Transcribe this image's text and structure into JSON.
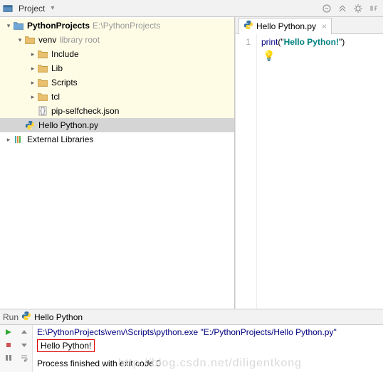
{
  "toolbar": {
    "project_label": "Project"
  },
  "tree": {
    "root": {
      "name": "PythonProjects",
      "path": "E:\\PythonProjects"
    },
    "venv": {
      "name": "venv",
      "tag": "library root"
    },
    "dirs": [
      "Include",
      "Lib",
      "Scripts",
      "tcl"
    ],
    "pip_file": "pip-selfcheck.json",
    "hello_file": "Hello Python.py",
    "ext_lib": "External Libraries"
  },
  "tab": {
    "label": "Hello Python.py"
  },
  "code": {
    "line_no": "1",
    "fn": "print",
    "paren_open": "(",
    "quote_open": "\"",
    "str": "Hello Python!",
    "quote_close": "\"",
    "paren_close": ")"
  },
  "run": {
    "tab_label": "Run",
    "name": "Hello Python",
    "cmd": "E:\\PythonProjects\\venv\\Scripts\\python.exe \"E:/PythonProjects/Hello Python.py\"",
    "out": "Hello Python!",
    "exit": "Process finished with exit code 0"
  },
  "watermark": "http://blog.csdn.net/diligentkong"
}
